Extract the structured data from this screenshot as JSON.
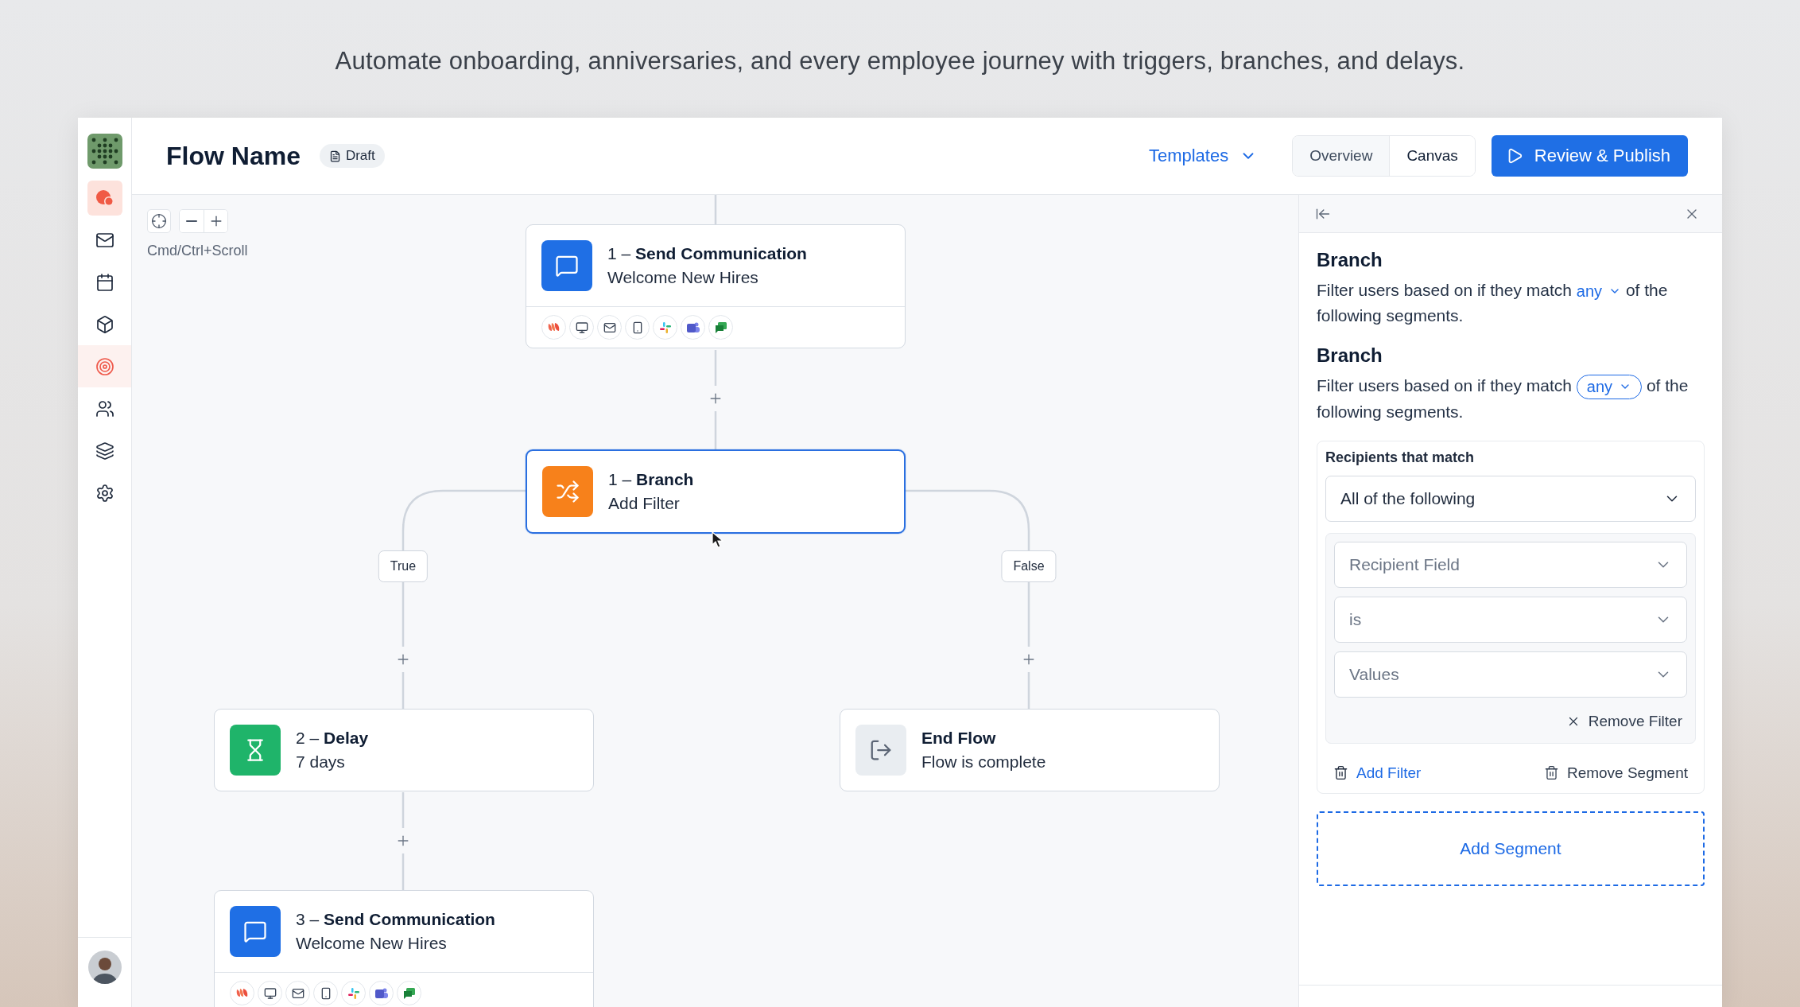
{
  "headline": "Automate onboarding, anniversaries, and every employee journey with triggers, branches, and delays.",
  "sidebar": {
    "items": [
      {
        "kind": "chat-app",
        "selected": false
      },
      {
        "kind": "mail",
        "selected": false
      },
      {
        "kind": "calendar",
        "selected": false
      },
      {
        "kind": "cube",
        "selected": false
      },
      {
        "kind": "target",
        "selected": true
      },
      {
        "kind": "users",
        "selected": false
      },
      {
        "kind": "layers",
        "selected": false
      },
      {
        "kind": "settings",
        "selected": false
      }
    ]
  },
  "header": {
    "title": "Flow Name",
    "status": "Draft",
    "templates": "Templates",
    "view_tabs": [
      {
        "label": "Overview",
        "selected": false
      },
      {
        "label": "Canvas",
        "selected": true
      }
    ],
    "publish": "Review & Publish"
  },
  "canvas": {
    "zoom_hint": "Cmd/Ctrl+Scroll",
    "nodes": [
      {
        "kind": "communication",
        "number": "1 –",
        "title": "Send Communication",
        "subtitle": "Welcome New Hires",
        "selected": false,
        "channels": [
          {
            "kind": "petals"
          },
          {
            "kind": "desktop"
          },
          {
            "kind": "mail"
          },
          {
            "kind": "mobile"
          },
          {
            "kind": "pinwheel"
          },
          {
            "kind": "team-chat"
          },
          {
            "kind": "chat-bubbles"
          }
        ]
      },
      {
        "kind": "branch",
        "number": "1 –",
        "title": "Branch",
        "subtitle": "Add Filter",
        "selected": true
      },
      {
        "kind": "delay",
        "number": "2 –",
        "title": "Delay",
        "subtitle": "7 days",
        "selected": false
      },
      {
        "kind": "end",
        "title": "End Flow",
        "subtitle": "Flow is complete",
        "selected": false
      },
      {
        "kind": "communication",
        "number": "3 –",
        "title": "Send Communication",
        "subtitle": "Welcome New Hires",
        "selected": false,
        "channels": [
          {
            "kind": "petals"
          },
          {
            "kind": "desktop"
          },
          {
            "kind": "mail"
          },
          {
            "kind": "mobile"
          },
          {
            "kind": "pinwheel"
          },
          {
            "kind": "team-chat"
          },
          {
            "kind": "chat-bubbles"
          }
        ]
      }
    ],
    "branch_labels": [
      "True",
      "False"
    ]
  },
  "panel": {
    "sections": [
      {
        "kind": "inline",
        "title": "Branch",
        "text_before": "Filter users based on if they match",
        "match": "any",
        "text_after": "of the following segments."
      },
      {
        "kind": "pill",
        "title": "Branch",
        "text_before": "Filter users based on if they match",
        "match": "any",
        "text_after": "of the following segments."
      }
    ],
    "segment": {
      "label": "Recipients that match",
      "mode": "All of the following",
      "filters": [
        {
          "placeholder": "Recipient Field"
        },
        {
          "placeholder": "is"
        },
        {
          "placeholder": "Values"
        }
      ],
      "remove_filter": "Remove Filter",
      "add_filter": "Add Filter",
      "remove_segment": "Remove Segment"
    },
    "add_segment": "Add Segment"
  }
}
